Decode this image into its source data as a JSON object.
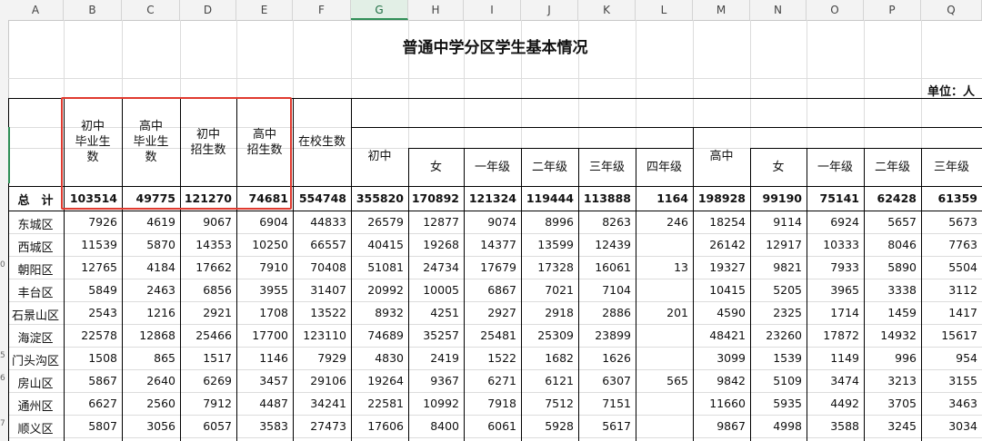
{
  "columns": [
    "A",
    "B",
    "C",
    "D",
    "E",
    "F",
    "G",
    "H",
    "I",
    "J",
    "K",
    "L",
    "M",
    "N",
    "O",
    "P",
    "Q"
  ],
  "selected_column": "G",
  "row_numbers": [
    "",
    "",
    "",
    "",
    "",
    "",
    "",
    "0",
    "",
    "",
    "",
    "",
    "5",
    "6",
    "7"
  ],
  "title": "普通中学分区学生基本情况",
  "unit": "单位：人",
  "headers": {
    "junior_grad": "初中\n毕业生\n数",
    "senior_grad": "高中\n毕业生\n数",
    "junior_enroll": "初中\n招生数",
    "senior_enroll": "高中\n招生数",
    "in_school": "在校生数",
    "junior": "初中",
    "female": "女",
    "grade1": "一年级",
    "grade2": "二年级",
    "grade3": "三年级",
    "grade4": "四年级",
    "senior": "高中",
    "senior_female": "女",
    "senior_grade1": "一年级",
    "senior_grade2": "二年级",
    "senior_grade3": "三年级"
  },
  "rows": [
    {
      "label": "总　计",
      "values": [
        "103514",
        "49775",
        "121270",
        "74681",
        "554748",
        "355820",
        "170892",
        "121324",
        "119444",
        "113888",
        "1164",
        "198928",
        "99190",
        "75141",
        "62428",
        "61359"
      ]
    },
    {
      "label": "东城区",
      "values": [
        "7926",
        "4619",
        "9067",
        "6904",
        "44833",
        "26579",
        "12877",
        "9074",
        "8996",
        "8263",
        "246",
        "18254",
        "9114",
        "6924",
        "5657",
        "5673"
      ]
    },
    {
      "label": "西城区",
      "values": [
        "11539",
        "5870",
        "14353",
        "10250",
        "66557",
        "40415",
        "19268",
        "14377",
        "13599",
        "12439",
        "",
        "26142",
        "12917",
        "10333",
        "8046",
        "7763"
      ]
    },
    {
      "label": "朝阳区",
      "values": [
        "12765",
        "4184",
        "17662",
        "7910",
        "70408",
        "51081",
        "24734",
        "17679",
        "17328",
        "16061",
        "13",
        "19327",
        "9821",
        "7933",
        "5890",
        "5504"
      ]
    },
    {
      "label": "丰台区",
      "values": [
        "5849",
        "2463",
        "6856",
        "3955",
        "31407",
        "20992",
        "10005",
        "6867",
        "7021",
        "7104",
        "",
        "10415",
        "5205",
        "3965",
        "3338",
        "3112"
      ]
    },
    {
      "label": "石景山区",
      "values": [
        "2543",
        "1216",
        "2921",
        "1708",
        "13522",
        "8932",
        "4251",
        "2927",
        "2918",
        "2886",
        "201",
        "4590",
        "2325",
        "1714",
        "1459",
        "1417"
      ]
    },
    {
      "label": "海淀区",
      "values": [
        "22578",
        "12868",
        "25466",
        "17700",
        "123110",
        "74689",
        "35257",
        "25481",
        "25309",
        "23899",
        "",
        "48421",
        "23260",
        "17872",
        "14932",
        "15617"
      ]
    },
    {
      "label": "门头沟区",
      "values": [
        "1508",
        "865",
        "1517",
        "1146",
        "7929",
        "4830",
        "2419",
        "1522",
        "1682",
        "1626",
        "",
        "3099",
        "1539",
        "1149",
        "996",
        "954"
      ]
    },
    {
      "label": "房山区",
      "values": [
        "5867",
        "2640",
        "6269",
        "3457",
        "29106",
        "19264",
        "9367",
        "6271",
        "6121",
        "6307",
        "565",
        "9842",
        "5109",
        "3474",
        "3213",
        "3155"
      ]
    },
    {
      "label": "通州区",
      "values": [
        "6627",
        "2560",
        "7912",
        "4487",
        "34241",
        "22581",
        "10992",
        "7918",
        "7512",
        "7151",
        "",
        "11660",
        "5935",
        "4492",
        "3705",
        "3463"
      ]
    },
    {
      "label": "顺义区",
      "values": [
        "5807",
        "3056",
        "6057",
        "3583",
        "27473",
        "17606",
        "8400",
        "6061",
        "5928",
        "5617",
        "",
        "9867",
        "4998",
        "3588",
        "3245",
        "3034"
      ]
    }
  ]
}
